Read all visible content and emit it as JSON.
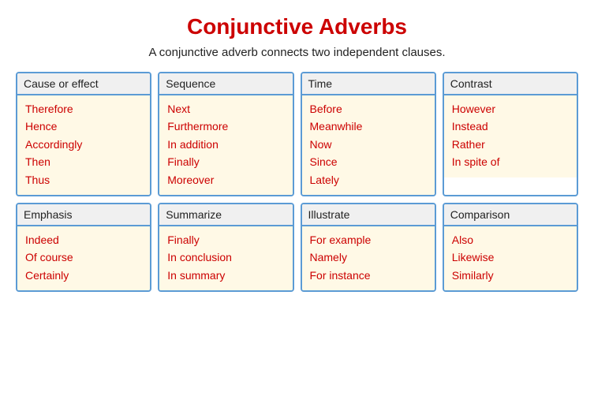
{
  "title": "Conjunctive Adverbs",
  "subtitle": "A conjunctive adverb connects two independent clauses.",
  "cards": [
    {
      "id": "cause-effect",
      "header": "Cause or effect",
      "terms": [
        "Therefore",
        "Hence",
        "Accordingly",
        "Then",
        "Thus"
      ]
    },
    {
      "id": "sequence",
      "header": "Sequence",
      "terms": [
        "Next",
        "Furthermore",
        "In addition",
        "Finally",
        "Moreover"
      ]
    },
    {
      "id": "time",
      "header": "Time",
      "terms": [
        "Before",
        "Meanwhile",
        "Now",
        "Since",
        "Lately"
      ]
    },
    {
      "id": "contrast",
      "header": "Contrast",
      "terms": [
        "However",
        "Instead",
        "Rather",
        "In spite of"
      ]
    },
    {
      "id": "emphasis",
      "header": "Emphasis",
      "terms": [
        "Indeed",
        "Of course",
        "Certainly"
      ]
    },
    {
      "id": "summarize",
      "header": "Summarize",
      "terms": [
        "Finally",
        "In conclusion",
        "In summary"
      ]
    },
    {
      "id": "illustrate",
      "header": "Illustrate",
      "terms": [
        "For example",
        "Namely",
        "For instance"
      ]
    },
    {
      "id": "comparison",
      "header": "Comparison",
      "terms": [
        "Also",
        "Likewise",
        "Similarly"
      ]
    }
  ]
}
